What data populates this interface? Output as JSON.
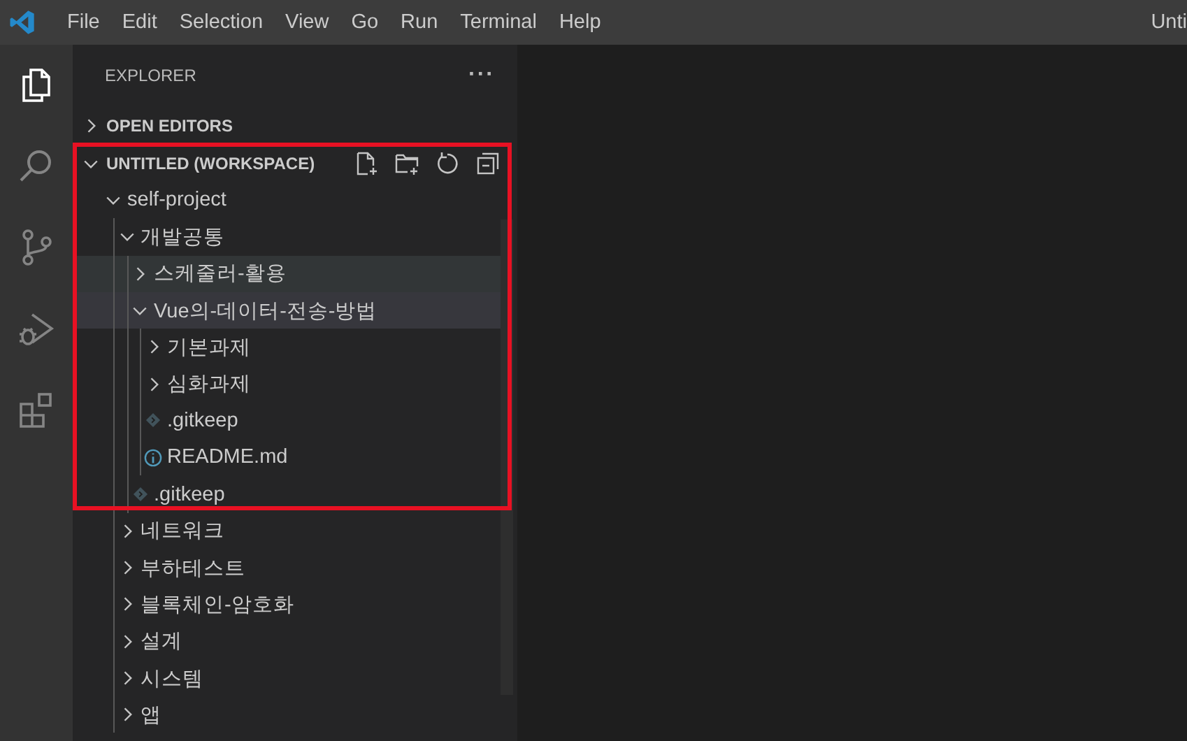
{
  "title_bar": {
    "menu": [
      "File",
      "Edit",
      "Selection",
      "View",
      "Go",
      "Run",
      "Terminal",
      "Help"
    ],
    "title": "Unti"
  },
  "activity_bar": [
    {
      "kind": "files",
      "selected": true
    },
    {
      "kind": "search",
      "selected": false
    },
    {
      "kind": "source-control",
      "selected": false
    },
    {
      "kind": "run-debug",
      "selected": false
    },
    {
      "kind": "extensions",
      "selected": false
    }
  ],
  "explorer": {
    "header": "EXPLORER",
    "more": "···",
    "sections": [
      {
        "label": "OPEN EDITORS",
        "expanded": false
      },
      {
        "label": "UNTITLED (WORKSPACE)",
        "expanded": true
      }
    ],
    "highlight_frame": true,
    "tree": [
      {
        "kind": "folder",
        "label": "self-project",
        "expanded": true,
        "selected": false,
        "hovered": false,
        "children": [
          {
            "kind": "folder",
            "label": "개발공통",
            "expanded": true,
            "selected": false,
            "hovered": false,
            "children": [
              {
                "kind": "folder",
                "label": "스케줄러-활용",
                "expanded": false,
                "selected": false,
                "hovered": true
              },
              {
                "kind": "folder",
                "label": "Vue의-데이터-전송-방법",
                "expanded": true,
                "selected": true,
                "hovered": false,
                "children": [
                  {
                    "kind": "folder",
                    "label": "기본과제",
                    "expanded": false,
                    "selected": false,
                    "hovered": false
                  },
                  {
                    "kind": "folder",
                    "label": "심화과제",
                    "expanded": false,
                    "selected": false,
                    "hovered": false
                  },
                  {
                    "kind": "git-file",
                    "label": ".gitkeep",
                    "selected": false,
                    "hovered": false
                  },
                  {
                    "kind": "info-file",
                    "label": "README.md",
                    "selected": false,
                    "hovered": false
                  }
                ]
              },
              {
                "kind": "git-file",
                "label": ".gitkeep",
                "selected": false,
                "hovered": false
              }
            ]
          },
          {
            "kind": "folder",
            "label": "네트워크",
            "expanded": false,
            "selected": false,
            "hovered": false
          },
          {
            "kind": "folder",
            "label": "부하테스트",
            "expanded": false,
            "selected": false,
            "hovered": false
          },
          {
            "kind": "folder",
            "label": "블록체인-암호화",
            "expanded": false,
            "selected": false,
            "hovered": false
          },
          {
            "kind": "folder",
            "label": "설계",
            "expanded": false,
            "selected": false,
            "hovered": false
          },
          {
            "kind": "folder",
            "label": "시스템",
            "expanded": false,
            "selected": false,
            "hovered": false
          },
          {
            "kind": "folder",
            "label": "앱",
            "expanded": false,
            "selected": false,
            "hovered": false
          }
        ]
      }
    ]
  }
}
